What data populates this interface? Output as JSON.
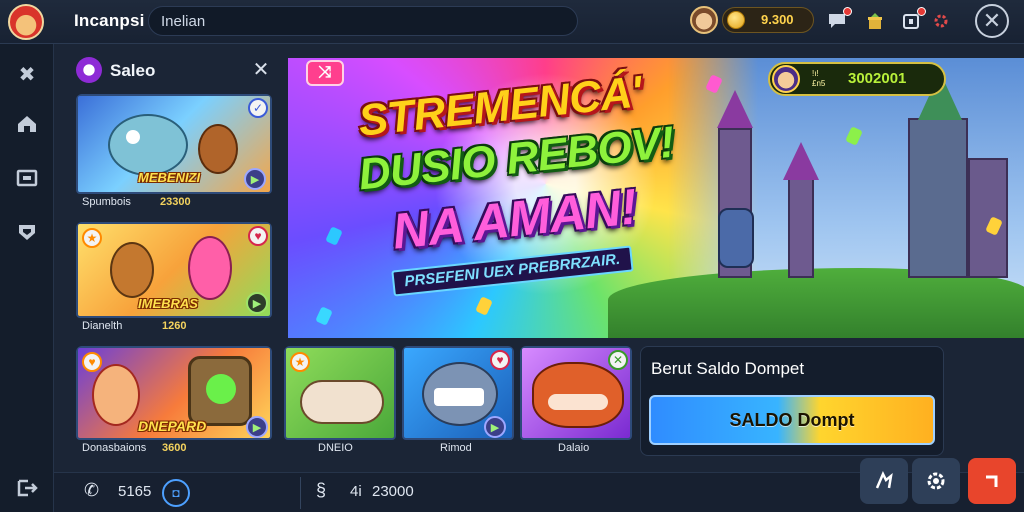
{
  "app": {
    "title": "Incanpsi",
    "search_value": "Inelian"
  },
  "topbar": {
    "coin_value": "9.300",
    "icons": [
      "avatar-icon",
      "coin-icon",
      "chat-icon",
      "gift-icon",
      "wallet-icon",
      "settings-icon",
      "close-icon"
    ]
  },
  "rail": {
    "icons": [
      "crossed-tools-icon",
      "home-icon",
      "screen-icon",
      "shield-icon",
      "exit-icon"
    ]
  },
  "panel": {
    "title": "Saleo",
    "cards": [
      {
        "art_title": "MEBENIZI",
        "name": "Spumbois",
        "value": "23300"
      },
      {
        "art_title": "IMEBRAS",
        "name": "Dianelth",
        "value": "1260"
      }
    ]
  },
  "hero": {
    "line1": "STREMENCÁ'",
    "line2": "DUSIO REBOV!",
    "line3": "NA AMAN!",
    "subtitle": "PRSEFENI UEX PREBRRZAIR.",
    "pill_small_1": "ǃıǃ",
    "pill_small_2": "£n5",
    "pill_value": "3002001"
  },
  "games": [
    {
      "art_title": "DNEPARD",
      "name": "Donasbaions",
      "value": "3600"
    },
    {
      "name": "DNEIO",
      "value": ""
    },
    {
      "name": "Rimod",
      "value": ""
    },
    {
      "name": "Dalaio",
      "value": ""
    }
  ],
  "promo": {
    "title": "Berut Saldo Dompet",
    "button_label": "SALDO Dompt"
  },
  "bottombar": {
    "left_value": "5165",
    "middle_label": "4i",
    "middle_value": "23000"
  },
  "colors": {
    "background": "#1b2536",
    "accent_blue": "#38b4ff",
    "accent_yellow": "#ffd52e",
    "danger": "#e8452c"
  }
}
